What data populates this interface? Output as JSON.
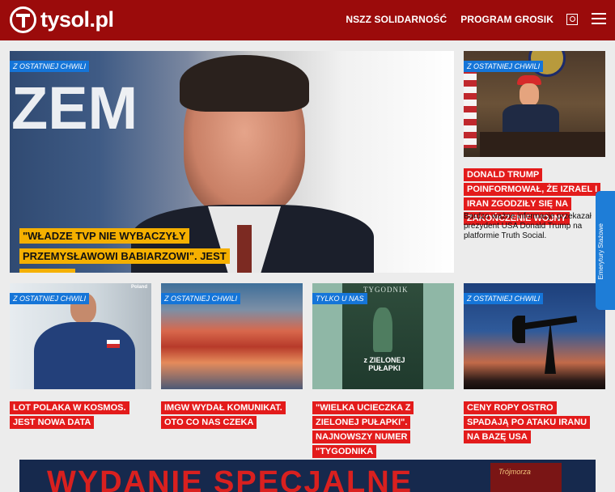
{
  "brand": {
    "name": "tysol.pl"
  },
  "nav": {
    "items": [
      "NSZZ SOLIDARNOŚĆ",
      "PROGRAM GROSIK"
    ]
  },
  "icons": {
    "search": "search-icon",
    "menu": "hamburger-menu-icon"
  },
  "hero": {
    "badge": "Z OSTATNIEJ CHWILI",
    "title": "\"Władze TVP nie wybaczyły Przemysławowi Babiarzowi\". Jest decyzja",
    "bg_text": "ZEM"
  },
  "side": {
    "badge": "Z OSTATNIEJ CHWILI",
    "title": "Donald Trump poinformował, że Izrael i Iran zgodziły się na zakończenie wojny",
    "desc": "Bardzo ważne informacje przekazał prezydent USA Donald Trump na platformie Truth Social."
  },
  "cards": [
    {
      "badge": "Z OSTATNIEJ CHWILI",
      "title": "Lot Polaka w kosmos. Jest nowa data",
      "corner": "Poland"
    },
    {
      "badge": "Z OSTATNIEJ CHWILI",
      "title": "IMGW wydał komunikat. Oto co nas czeka"
    },
    {
      "badge": "TYLKO U NAS",
      "title": "\"Wielka ucieczka z zielonej pułapki\". Najnowszy numer \"Tygodnika Solidarność\"",
      "cover_title": "TYGODNIK",
      "cover_text": "z ZIELONEJ PUŁAPKI"
    },
    {
      "badge": "Z OSTATNIEJ CHWILI",
      "title": "Ceny ropy ostro spadają po ataku Iranu na bazę USA"
    }
  ],
  "side_tab": {
    "label": "Emerytury Stażowe"
  },
  "banner": {
    "text": "WYDANIE SPECJALNE",
    "book_text": "Trójmorza"
  },
  "colors": {
    "brand_red": "#9b0b0b",
    "badge_blue": "#1575d8",
    "headline_red": "#e31b1b",
    "hero_yellow": "#f5b000"
  }
}
